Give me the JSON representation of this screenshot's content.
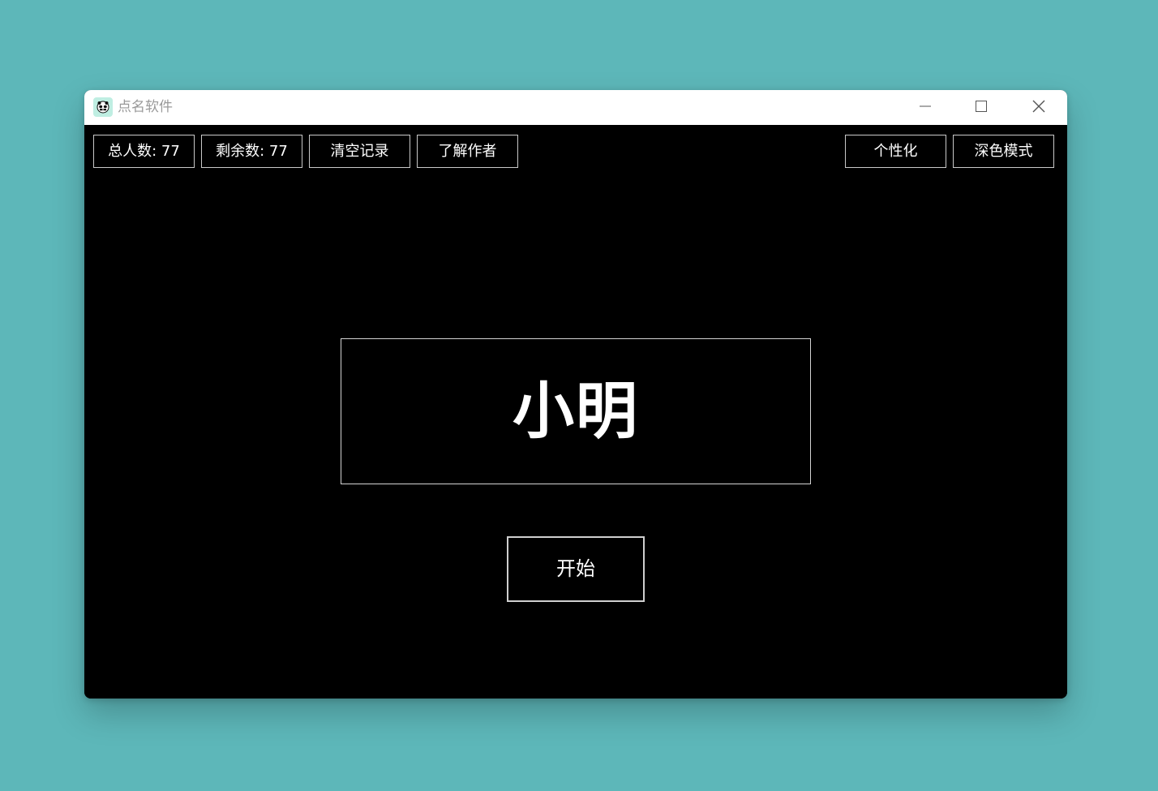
{
  "window": {
    "title": "点名软件"
  },
  "toolbar": {
    "total_label": "总人数: 77",
    "remaining_label": "剩余数: 77",
    "clear_label": "清空记录",
    "author_label": "了解作者",
    "personalize_label": "个性化",
    "dark_mode_label": "深色模式"
  },
  "main": {
    "selected_name": "小明",
    "start_label": "开始"
  },
  "colors": {
    "desktop": "#5db7b9",
    "titlebar": "#ffffff",
    "content": "#000000",
    "border": "#c9c9c9",
    "text": "#ffffff",
    "icon_bg": "#bfeee2"
  },
  "icons": {
    "app": "panda-icon",
    "minimize": "minimize-icon",
    "maximize": "maximize-icon",
    "close": "close-icon"
  }
}
